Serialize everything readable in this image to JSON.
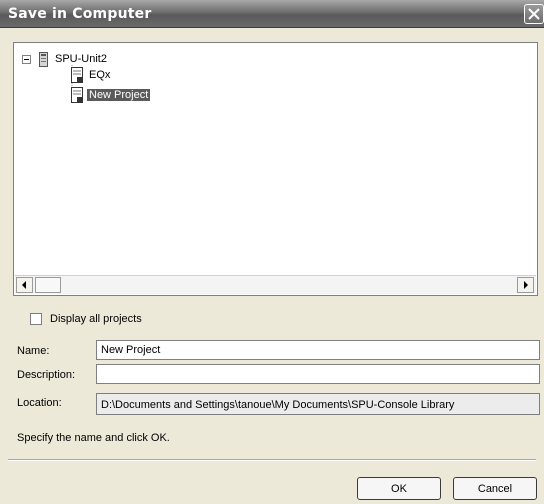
{
  "window": {
    "title": "Save in Computer"
  },
  "icons": {
    "close": "close-icon",
    "expand": "minus-box-icon",
    "unit": "device-icon",
    "project": "document-icon",
    "scroll_left": "arrow-left-icon",
    "scroll_right": "arrow-right-icon"
  },
  "tree": {
    "root": {
      "label": "SPU-Unit2",
      "expanded": true
    },
    "children": [
      {
        "label": "EQx",
        "selected": false
      },
      {
        "label": "New Project",
        "selected": true
      }
    ]
  },
  "display_all": {
    "label": "Display all projects",
    "checked": false
  },
  "fields": {
    "name": {
      "label": "Name:",
      "value": "New Project"
    },
    "description": {
      "label": "Description:",
      "value": ""
    },
    "location": {
      "label": "Location:",
      "value": "D:\\Documents and Settings\\tanoue\\My Documents\\SPU-Console Library"
    }
  },
  "hint": "Specify the name and click OK.",
  "buttons": {
    "ok": "OK",
    "cancel": "Cancel"
  },
  "colors": {
    "selection": "#5a5a5a",
    "dialog_bg": "#ece9d8"
  }
}
